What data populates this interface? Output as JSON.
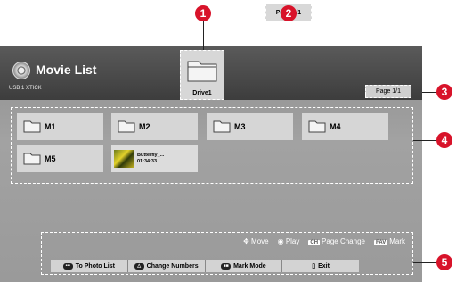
{
  "header": {
    "title": "Movie List",
    "source": "USB 1 XTICK",
    "drive_label": "Drive1",
    "page_top": "Page 1/1",
    "page_right": "Page 1/1"
  },
  "items": [
    {
      "label": "M1"
    },
    {
      "label": "M2"
    },
    {
      "label": "M3"
    },
    {
      "label": "M4"
    },
    {
      "label": "M5"
    },
    {
      "label": "Butterfly_...",
      "time": "01:34:33"
    }
  ],
  "legend": {
    "move": "Move",
    "play": "Play",
    "page_change": "Page Change",
    "mark": "Mark",
    "mark_key": "FAV",
    "ch_key": "CH"
  },
  "buttons": [
    {
      "label": "To Photo List",
      "key": "•••"
    },
    {
      "label": "Change Numbers",
      "key": "△"
    },
    {
      "label": "Mark Mode",
      "key": "■■"
    },
    {
      "label": "Exit",
      "key": "▯"
    }
  ],
  "callouts": [
    "1",
    "2",
    "3",
    "4",
    "5"
  ]
}
